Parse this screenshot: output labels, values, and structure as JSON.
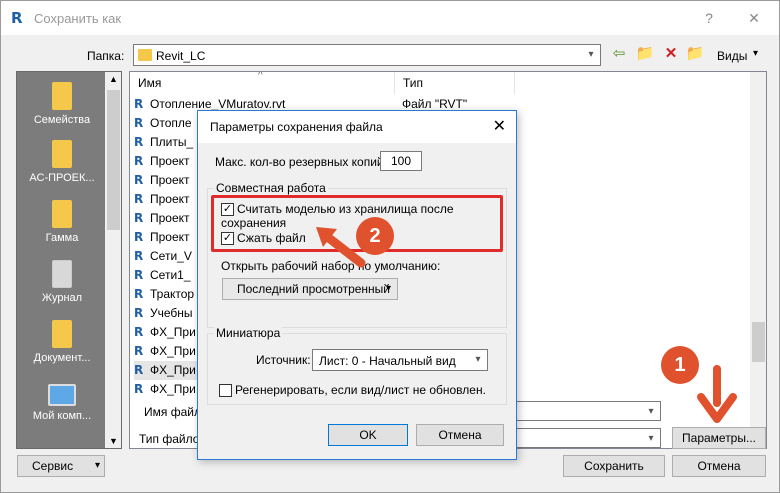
{
  "window": {
    "title": "Сохранить как",
    "help_label": "?",
    "close_label": "✕"
  },
  "toolbar": {
    "folder_label": "Папка:",
    "folder_value": "Revit_LC",
    "views_label": "Виды"
  },
  "places": [
    {
      "label": "Семейства",
      "icon": "folder-icon"
    },
    {
      "label": "АС-ПРОЕК...",
      "icon": "folder-icon"
    },
    {
      "label": "Гамма",
      "icon": "folder-icon"
    },
    {
      "label": "Журнал",
      "icon": "journal-icon"
    },
    {
      "label": "Документ...",
      "icon": "documents-icon"
    },
    {
      "label": "Мой комп...",
      "icon": "computer-icon"
    }
  ],
  "filelist": {
    "col_name": "Имя",
    "col_type": "Тип",
    "rows": [
      {
        "name": "Отопление_VMuratov.rvt",
        "type": "Файл \"RVT\""
      },
      {
        "name": "Отопле",
        "type": ""
      },
      {
        "name": "Плиты_",
        "type": ""
      },
      {
        "name": "Проект",
        "type": ""
      },
      {
        "name": "Проект",
        "type": ""
      },
      {
        "name": "Проект",
        "type": ""
      },
      {
        "name": "Проект",
        "type": ""
      },
      {
        "name": "Проект",
        "type": ""
      },
      {
        "name": "Сети_V",
        "type": ""
      },
      {
        "name": "Сети1_",
        "type": ""
      },
      {
        "name": "Трактор",
        "type": ""
      },
      {
        "name": "Учебны",
        "type": ""
      },
      {
        "name": "ФХ_При",
        "type": ""
      },
      {
        "name": "ФХ_При",
        "type": ""
      },
      {
        "name": "ФХ_При",
        "type": ""
      },
      {
        "name": "ФХ_При",
        "type": ""
      }
    ]
  },
  "bottom": {
    "filename_label": "Имя файла",
    "filetype_label": "Тип файлов",
    "options_button": "Параметры...",
    "service_button": "Сервис",
    "save_button": "Сохранить",
    "cancel_button": "Отмена"
  },
  "dialog": {
    "title": "Параметры сохранения файла",
    "close": "✕",
    "max_backups_label": "Макс. кол-во резервных копий:",
    "max_backups_value": "100",
    "collab_legend": "Совместная работа",
    "compact_central_label": "Считать моделью из хранилища после сохранения",
    "compact_label": "Сжать файл",
    "open_workset_label": "Открыть рабочий набор по умолчанию:",
    "open_workset_value": "Последний просмотренный",
    "thumb_legend": "Миниатюра",
    "source_label": "Источник:",
    "source_value": "Лист: 0 - Начальный вид",
    "regen_label": "Регенерировать, если вид/лист не обновлен.",
    "ok": "OK",
    "cancel": "Отмена"
  },
  "annotations": {
    "badge1": "1",
    "badge2": "2",
    "accent": "#e0522e"
  }
}
